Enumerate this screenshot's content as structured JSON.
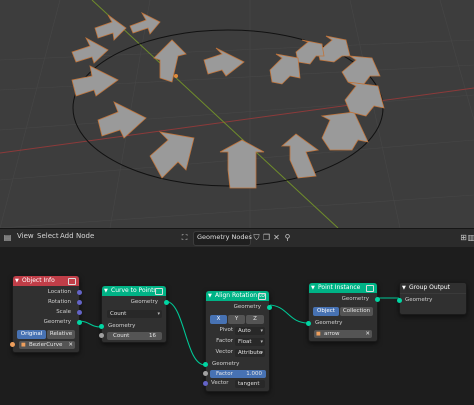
{
  "toolbar": {
    "view": "View",
    "select": "Select",
    "add": "Add",
    "node": "Node",
    "tree_name": "Geometry Nodes"
  },
  "colors": {
    "object_info": "#c03e48",
    "curve_to_points": "#00b386",
    "align_rotation": "#00b386",
    "point_instance": "#00b386",
    "group_output": "#303030",
    "geometry_socket": "#00d6a3",
    "vector_socket": "#6363c7",
    "float_socket": "#a1a1a1",
    "object_socket": "#ed9e5c"
  },
  "nodes": {
    "object_info": {
      "title": "Object Info",
      "outputs": [
        "Location",
        "Rotation",
        "Scale",
        "Geometry"
      ],
      "mode_buttons": [
        "Original",
        "Relative"
      ],
      "object": "BezierCurve"
    },
    "curve_to_points": {
      "title": "Curve to Points",
      "output": "Geometry",
      "mode": "Count",
      "input": "Geometry",
      "count_label": "Count",
      "count_value": "16"
    },
    "align_rotation": {
      "title": "Align Rotation to",
      "output": "Geometry",
      "axes": [
        "X",
        "Y",
        "Z"
      ],
      "pivot_label": "Pivot",
      "pivot_value": "Auto",
      "factor_label": "Factor",
      "factor_value": "Float",
      "vector_label": "Vector",
      "vector_value": "Attribute",
      "input_geometry": "Geometry",
      "factor_field_label": "Factor",
      "factor_field_value": "1.000",
      "vector_field_label": "Vector",
      "vector_field_value": "tangent"
    },
    "point_instance": {
      "title": "Point Instance",
      "output": "Geometry",
      "buttons": [
        "Object",
        "Collection"
      ],
      "input": "Geometry",
      "object": "arrow"
    },
    "group_output": {
      "title": "Group Output",
      "input": "Geometry"
    }
  }
}
